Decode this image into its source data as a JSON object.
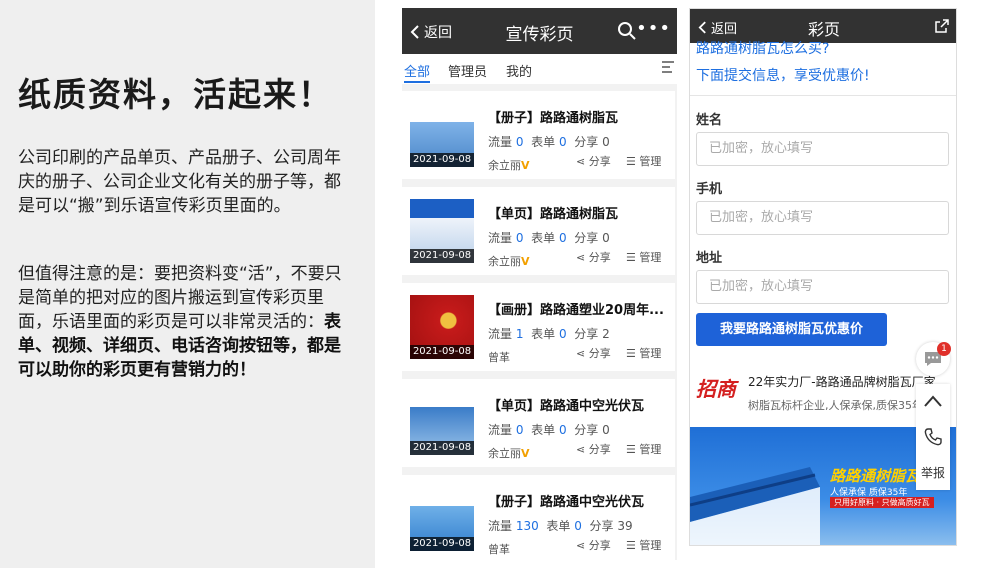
{
  "left": {
    "title": "纸质资料，活起来！",
    "p1": "公司印刷的产品单页、产品册子、公司周年庆的册子、公司企业文化有关的册子等，都是可以“搬”到乐语宣传彩页里面的。",
    "p2_normal": "但值得注意的是：要把资料变“活”，不要只是简单的把对应的图片搬运到宣传彩页里面，乐语里面的彩页是可以非常灵活的：",
    "p2_bold": "表单、视频、详细页、电话咨询按钮等，都是可以助你的彩页更有营销力的！"
  },
  "phone1": {
    "back": "返回",
    "title": "宣传彩页",
    "more": "•••",
    "tabs": [
      "全部",
      "管理员",
      "我的"
    ],
    "labels": {
      "flow": "流量",
      "form": "表单",
      "share": "分享",
      "share_btn": "分享",
      "manage": "管理"
    },
    "items": [
      {
        "title": "【册子】路路通树脂瓦",
        "flow": "0",
        "form": "0",
        "share": "0",
        "date": "2021-09-08",
        "owner": "余立丽",
        "v": "V"
      },
      {
        "title": "【单页】路路通树脂瓦",
        "flow": "0",
        "form": "0",
        "share": "0",
        "date": "2021-09-08",
        "owner": "余立丽",
        "v": "V"
      },
      {
        "title": "【画册】路路通塑业20周年...",
        "flow": "1",
        "form": "0",
        "share": "2",
        "date": "2021-09-08",
        "owner": "曾革",
        "v": ""
      },
      {
        "title": "【单页】路路通中空光伏瓦",
        "flow": "0",
        "form": "0",
        "share": "0",
        "date": "2021-09-08",
        "owner": "余立丽",
        "v": "V"
      },
      {
        "title": "【册子】路路通中空光伏瓦",
        "flow": "130",
        "form": "0",
        "share": "39",
        "date": "2021-09-08",
        "owner": "曾革",
        "v": ""
      }
    ]
  },
  "phone2": {
    "back": "返回",
    "title": "彩页",
    "ask": "路路通树脂瓦怎么买?",
    "ask2": "下面提交信息，享受优惠价!",
    "fields": [
      {
        "label": "姓名",
        "placeholder": "已加密，放心填写"
      },
      {
        "label": "手机",
        "placeholder": "已加密，放心填写"
      },
      {
        "label": "地址",
        "placeholder": "已加密，放心填写"
      }
    ],
    "submit": "我要路路通树脂瓦优惠价",
    "promo_logo": "招商",
    "promo_title": "22年实力厂-路路通品牌树脂瓦厂家...",
    "promo_sub": "树脂瓦标杆企业,人保承保,质保35年",
    "banner_title": "路路通树脂瓦",
    "banner_sub": "人保承保   质保35年",
    "banner_bar": "只用好原料 · 只做高质好瓦",
    "badge": "1",
    "report": "举报"
  }
}
